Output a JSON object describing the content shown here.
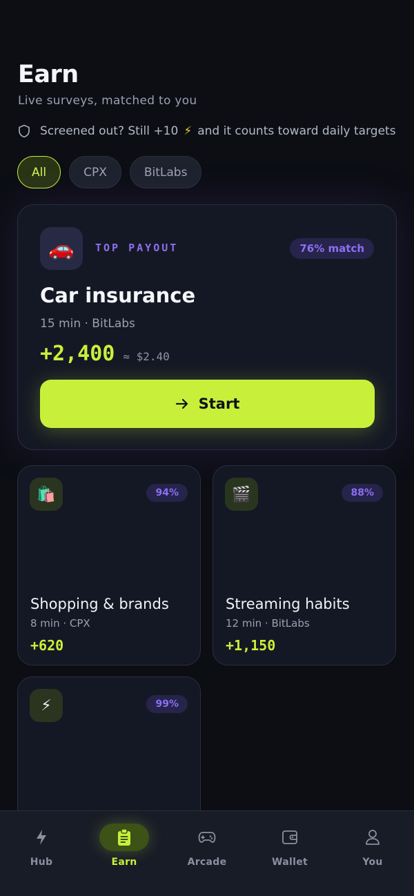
{
  "header": {
    "title": "Earn",
    "subtitle": "Live surveys, matched to you",
    "notice_prefix": "Screened out? Still +10",
    "notice_suffix": "and it counts toward daily targets"
  },
  "filters": [
    {
      "label": "All",
      "active": true
    },
    {
      "label": "CPX",
      "active": false
    },
    {
      "label": "BitLabs",
      "active": false
    }
  ],
  "hero": {
    "icon": "🚗",
    "tag": "TOP PAYOUT",
    "match": "76% match",
    "title": "Car insurance",
    "meta": "15 min · BitLabs",
    "points": "+2,400",
    "approx": "≈ $2.40",
    "button_label": "Start"
  },
  "surveys": [
    {
      "icon": "🛍️",
      "match": "94%",
      "title": "Shopping & brands",
      "meta": "8 min · CPX",
      "points": "+620"
    },
    {
      "icon": "🎬",
      "match": "88%",
      "title": "Streaming habits",
      "meta": "12 min · BitLabs",
      "points": "+1,150"
    },
    {
      "icon": "⚡",
      "match": "99%",
      "title": "",
      "meta": "",
      "points": ""
    }
  ],
  "nav": [
    {
      "label": "Hub",
      "icon": "bolt-icon",
      "active": false
    },
    {
      "label": "Earn",
      "icon": "clipboard-icon",
      "active": true
    },
    {
      "label": "Arcade",
      "icon": "gamepad-icon",
      "active": false
    },
    {
      "label": "Wallet",
      "icon": "wallet-icon",
      "active": false
    },
    {
      "label": "You",
      "icon": "user-icon",
      "active": false
    }
  ],
  "colors": {
    "background": "#0c0e14",
    "accent": "#c8f03b",
    "match": "#8c6ff5",
    "card": "#141824"
  }
}
